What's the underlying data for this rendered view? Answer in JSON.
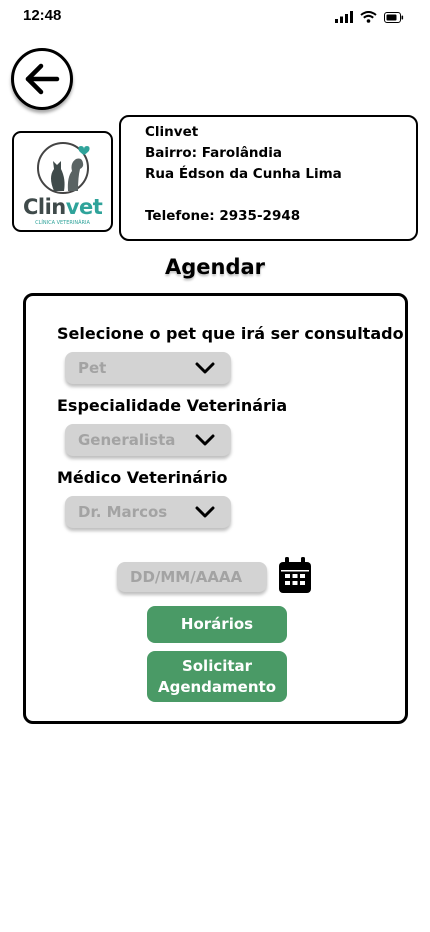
{
  "status_bar": {
    "time": "12:48"
  },
  "clinic": {
    "name": "Clinvet",
    "district": "Bairro: Farolândia",
    "street": "Rua Édson da Cunha Lima",
    "phone": "Telefone: 2935-2948",
    "logo_text": "Clinvet",
    "logo_subtitle": "CLÍNICA VETERINÁRIA"
  },
  "page": {
    "title": "Agendar"
  },
  "form": {
    "pet_label": "Selecione o pet que irá ser consultado",
    "pet_value": "Pet",
    "specialty_label": "Especialidade Veterinária",
    "specialty_value": "Generalista",
    "vet_label": "Médico Veterinário",
    "vet_value": "Dr. Marcos",
    "date_placeholder": "DD/MM/AAAA",
    "times_button": "Horários",
    "request_button_line1": "Solicitar",
    "request_button_line2": "Agendamento"
  },
  "colors": {
    "accent_green": "#4a9a66",
    "field_gray": "#d3d3d3",
    "logo_teal": "#2fa39a"
  },
  "icons": [
    "back-arrow-icon",
    "calendar-icon",
    "chevron-down-icon",
    "signal-icon",
    "wifi-icon",
    "battery-icon"
  ]
}
